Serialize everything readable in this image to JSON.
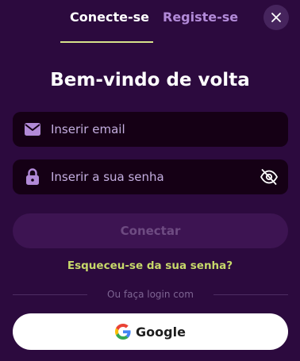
{
  "tabs": {
    "login_label": "Conecte-se",
    "register_label": "Registe-se"
  },
  "title": "Bem-vindo de volta",
  "email": {
    "placeholder": "Inserir email",
    "value": ""
  },
  "password": {
    "placeholder": "Inserir a sua senha",
    "value": ""
  },
  "connect_label": "Conectar",
  "forgot_label": "Esqueceu-se da sua senha?",
  "divider_label": "Ou faça login com",
  "google_label": "Google",
  "colors": {
    "background": "#2c0a3e",
    "accent": "#d7e28a",
    "link": "#c7d86a",
    "field_bg": "#150015",
    "icon_purple": "#b28ad8"
  },
  "icons": {
    "close": "close-icon",
    "email": "envelope-icon",
    "password": "lock-icon",
    "visibility": "eye-off-icon",
    "google": "google-icon"
  }
}
